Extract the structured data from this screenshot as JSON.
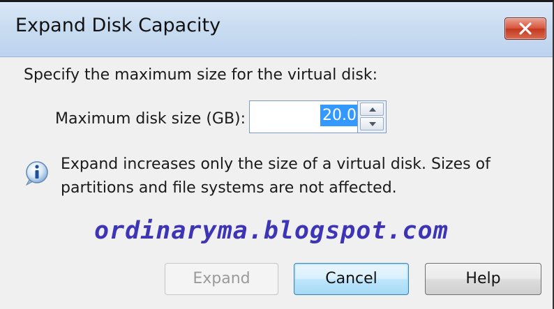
{
  "window": {
    "title": "Expand Disk Capacity",
    "close_icon": "close-icon"
  },
  "content": {
    "instruction": "Specify the maximum size for the virtual disk:",
    "size_field": {
      "label": "Maximum disk size (GB):",
      "value": "20.0"
    },
    "spinner_icons": [
      "spin-up-icon",
      "spin-down-icon"
    ],
    "info_icon": "info-icon",
    "info_text": "Expand increases only the size of a virtual disk. Sizes of partitions and file systems are not affected.",
    "watermark": "ordinaryma.blogspot.com"
  },
  "buttons": {
    "expand": "Expand",
    "cancel": "Cancel",
    "help": "Help"
  },
  "colors": {
    "selection": "#3399ff",
    "watermark": "#3d35b5",
    "titlebar": "#c9dcf1",
    "close_button": "#c3381f"
  }
}
